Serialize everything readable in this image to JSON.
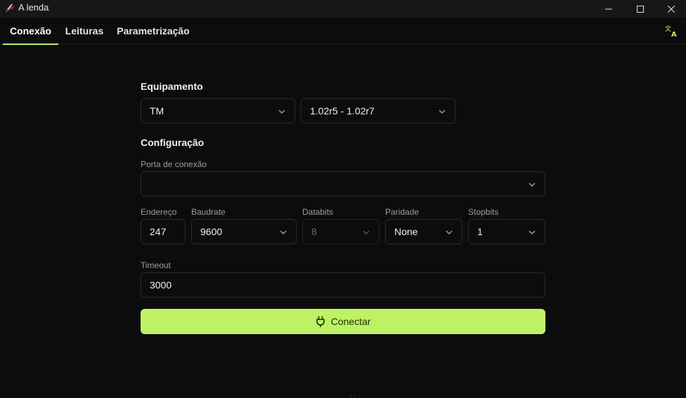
{
  "window": {
    "title": "A lenda",
    "controls": [
      "minimize-icon",
      "maximize-icon",
      "close-icon"
    ]
  },
  "tabs": [
    {
      "label": "Conexão",
      "active": true
    },
    {
      "label": "Leituras",
      "active": false
    },
    {
      "label": "Parametrização",
      "active": false
    }
  ],
  "accent_color": "#bef264",
  "form": {
    "equipment_title": "Equipamento",
    "equipment_select": "TM",
    "version_select": "1.02r5 - 1.02r7",
    "config_title": "Configuração",
    "port_label": "Porta de conexão",
    "port_value": "",
    "address_label": "Endereço",
    "address_value": "247",
    "baudrate_label": "Baudrate",
    "baudrate_value": "9600",
    "databits_label": "Databits",
    "databits_value": "8",
    "parity_label": "Paridade",
    "parity_value": "None",
    "stopbits_label": "Stopbits",
    "stopbits_value": "1",
    "timeout_label": "Timeout",
    "timeout_value": "3000",
    "connect_label": "Conectar"
  }
}
